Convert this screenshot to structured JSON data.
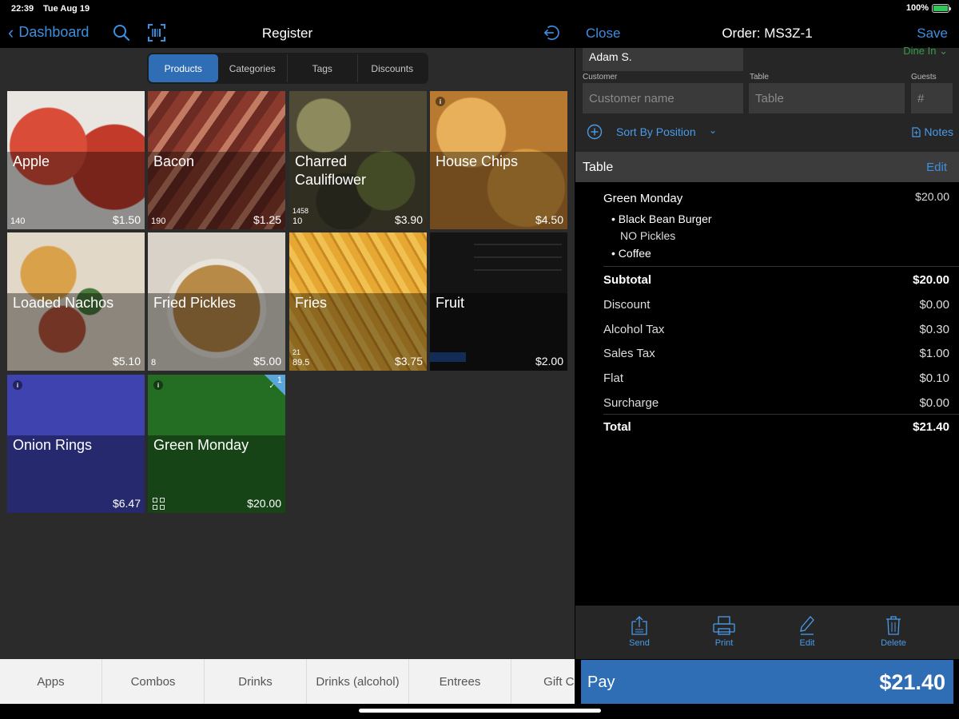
{
  "status": {
    "time": "22:39",
    "date": "Tue Aug 19",
    "battery": "100%"
  },
  "left_nav": {
    "back_label": "Dashboard",
    "title": "Register"
  },
  "segments": [
    "Products",
    "Categories",
    "Tags",
    "Discounts"
  ],
  "products": [
    {
      "name": "Apple",
      "price": "$1.50",
      "count": "140",
      "count2": "",
      "bg": "#b83b2d"
    },
    {
      "name": "Bacon",
      "price": "$1.25",
      "count": "190",
      "count2": "",
      "bg": "#7a3a2d"
    },
    {
      "name": "Charred Cauliflower",
      "price": "$3.90",
      "count": "10",
      "count2": "1458",
      "bg": "#5e5a3c"
    },
    {
      "name": "House Chips",
      "price": "$4.50",
      "count": "",
      "count2": "",
      "bg": "#c68a3e"
    },
    {
      "name": "Loaded Nachos",
      "price": "$5.10",
      "count": "",
      "count2": "",
      "bg": "#8b6a3d"
    },
    {
      "name": "Fried Pickles",
      "price": "$5.00",
      "count": "8",
      "count2": "",
      "bg": "#a07a3e"
    },
    {
      "name": "Fries",
      "price": "$3.75",
      "count": "89.5",
      "count2": "21",
      "bg": "#d09a30"
    },
    {
      "name": "Fruit",
      "price": "$2.00",
      "count": "",
      "count2": "",
      "bg": "#1e1e1e"
    },
    {
      "name": "Onion Rings",
      "price": "$6.47",
      "count": "",
      "count2": "",
      "bg": "#3e43b0"
    },
    {
      "name": "Green Monday",
      "price": "$20.00",
      "count": "",
      "count2": "",
      "bg": "#246e24",
      "badge": "1"
    }
  ],
  "categories": [
    "Apps",
    "Combos",
    "Drinks",
    "Drinks (alcohol)",
    "Entrees",
    "Gift Ca"
  ],
  "order": {
    "close_label": "Close",
    "title": "Order: MS3Z-1",
    "save_label": "Save",
    "name_value": "Adam S.",
    "dine_label": "Dine In",
    "customer_label": "Customer",
    "customer_placeholder": "Customer name",
    "table_label": "Table",
    "table_placeholder": "Table",
    "guests_label": "Guests",
    "guests_placeholder": "#",
    "sort_label": "Sort By Position",
    "notes_label": "Notes",
    "section_title": "Table",
    "section_edit": "Edit",
    "item": {
      "name": "Green Monday",
      "price": "$20.00",
      "sub1": "• Black Bean Burger",
      "mod1": "NO Pickles",
      "sub2": "• Coffee"
    },
    "totals": [
      {
        "label": "Subtotal",
        "value": "$20.00",
        "bold": true
      },
      {
        "label": "Discount",
        "value": "$0.00"
      },
      {
        "label": "Alcohol Tax",
        "value": "$0.30"
      },
      {
        "label": "Sales Tax",
        "value": "$1.00"
      },
      {
        "label": "Flat",
        "value": "$0.10"
      },
      {
        "label": "Surcharge",
        "value": "$0.00"
      },
      {
        "label": "Total",
        "value": "$21.40",
        "bold": true
      }
    ],
    "actions": [
      "Send",
      "Print",
      "Edit",
      "Delete"
    ],
    "pay_label": "Pay",
    "pay_amount": "$21.40"
  },
  "colors": {
    "accent": "#3d8fe0",
    "pay": "#2f6db5",
    "dine_in": "#3a9a48"
  }
}
